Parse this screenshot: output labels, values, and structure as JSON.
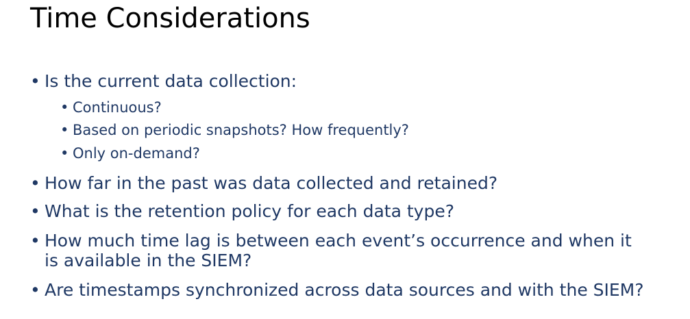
{
  "slide": {
    "title": "Time Considerations",
    "bullets": [
      {
        "text": "Is the current data collection:",
        "sub": [
          "Continuous?",
          "Based on periodic snapshots? How frequently?",
          "Only on-demand?"
        ]
      },
      {
        "text": "How far in the past was data collected and retained?"
      },
      {
        "text": "What is the retention policy for each data type?"
      },
      {
        "text": "How much time lag is between each event’s occurrence and when it",
        "text_cont": "is available in the SIEM?"
      },
      {
        "text": "Are timestamps synchronized across data sources and with the SIEM?"
      }
    ]
  },
  "colors": {
    "title": "#000000",
    "body": "#1f3864",
    "background": "#ffffff"
  }
}
